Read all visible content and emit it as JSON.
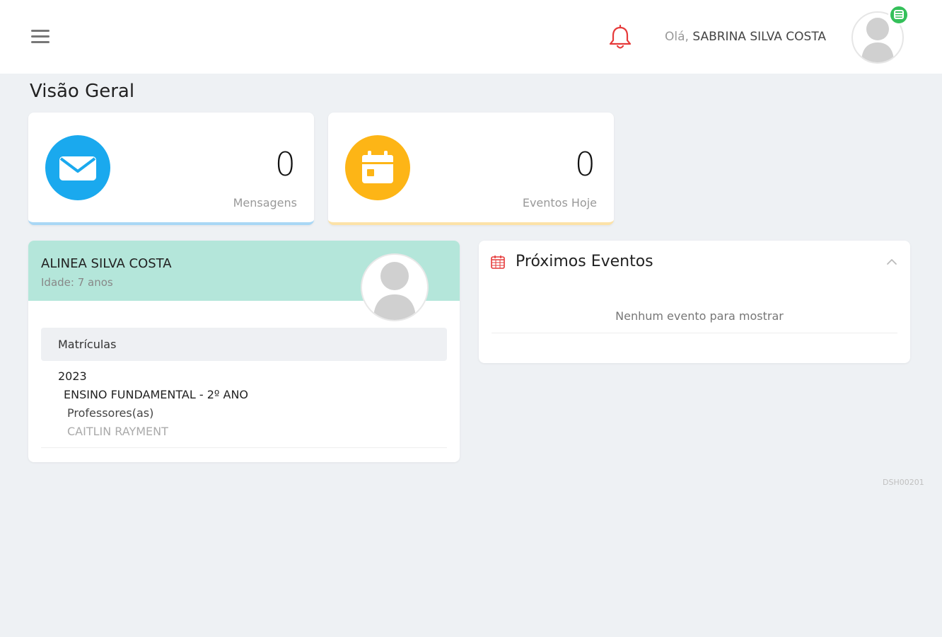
{
  "header": {
    "greeting_prefix": "Olá,",
    "user_name": "SABRINA SILVA COSTA"
  },
  "page": {
    "title": "Visão Geral"
  },
  "stats": [
    {
      "value": "0",
      "label": "Mensagens",
      "icon": "envelope-icon",
      "color": "#1aa9ee"
    },
    {
      "value": "0",
      "label": "Eventos Hoje",
      "icon": "calendar-icon",
      "color": "#fdb516"
    }
  ],
  "student": {
    "name": "ALINEA SILVA COSTA",
    "age": "Idade: 7 anos",
    "enrollments_title": "Matrículas",
    "year": "2023",
    "grade": "ENSINO FUNDAMENTAL - 2º ANO",
    "teachers_label": "Professores(as)",
    "teacher": "CAITLIN RAYMENT"
  },
  "events": {
    "title": "Próximos Eventos",
    "empty_message": "Nenhum evento para mostrar"
  },
  "footer": {
    "code": "DSH00201"
  },
  "colors": {
    "accent_blue": "#1aa9ee",
    "accent_yellow": "#fdb516",
    "student_header": "#b4e6da",
    "bell": "#e63a3a",
    "online_badge": "#34c05a"
  }
}
